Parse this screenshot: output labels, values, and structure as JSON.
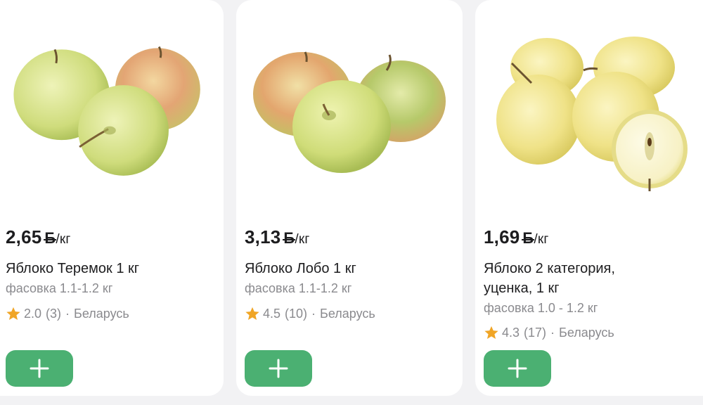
{
  "products": [
    {
      "price": "2,65",
      "currency_symbol": "Б",
      "unit": "/кг",
      "name": "Яблоко Теремок 1 кг",
      "pack": "фасовка 1.1-1.2 кг",
      "rating": "2.0",
      "reviews": "(3)",
      "country": "Беларусь"
    },
    {
      "price": "3,13",
      "currency_symbol": "Б",
      "unit": "/кг",
      "name": "Яблоко Лобо 1 кг",
      "pack": "фасовка 1.1-1.2 кг",
      "rating": "4.5",
      "reviews": "(10)",
      "country": "Беларусь"
    },
    {
      "price": "1,69",
      "currency_symbol": "Б",
      "unit": "/кг",
      "name": "Яблоко 2 категория, уценка, 1 кг",
      "pack": "фасовка 1.0 - 1.2 кг",
      "rating": "4.3",
      "reviews": "(17)",
      "country": "Беларусь"
    }
  ],
  "separator": "·",
  "colors": {
    "accent": "#4bb072",
    "star": "#f0a526",
    "muted": "#8a8a8e"
  },
  "icons": {
    "rating": "star-icon",
    "add": "plus-icon"
  }
}
